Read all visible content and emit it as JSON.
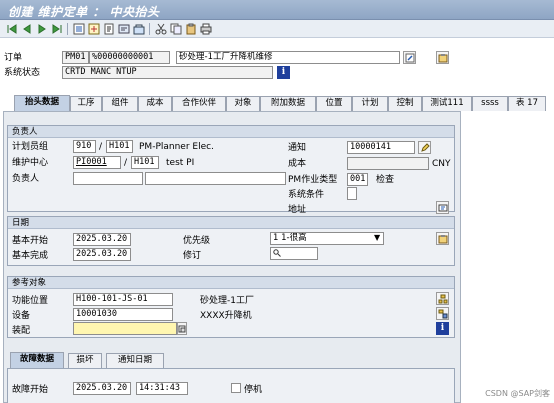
{
  "window": {
    "title": "创建 维护定单 ： 中央抬头"
  },
  "toolbar": {
    "icons": [
      "first-icon",
      "previous-icon",
      "next-icon",
      "last-icon",
      "operation-overview-icon",
      "components-icon",
      "costs-icon",
      "partner-icon",
      "objects-icon"
    ]
  },
  "header": {
    "order_label": "订单",
    "order_type": "PM01",
    "order_number": "%00000000001",
    "order_text": "砂处理-1工厂升降机维修",
    "status_label": "系统状态",
    "status_value": "CRTD MANC NTUP"
  },
  "tabs": [
    {
      "label": "抬头数据",
      "active": true
    },
    {
      "label": "工序",
      "active": false
    },
    {
      "label": "组件",
      "active": false
    },
    {
      "label": "成本",
      "active": false
    },
    {
      "label": "合作伙伴",
      "active": false
    },
    {
      "label": "对象",
      "active": false
    },
    {
      "label": "附加数据",
      "active": false
    },
    {
      "label": "位置",
      "active": false
    },
    {
      "label": "计划",
      "active": false
    },
    {
      "label": "控制",
      "active": false
    },
    {
      "label": "测试111",
      "active": false
    },
    {
      "label": "ssss",
      "active": false
    },
    {
      "label": "表 17",
      "active": false
    }
  ],
  "responsible": {
    "title": "负责人",
    "planner_group_label": "计划员组",
    "planner_group": "910",
    "planner_plant": "H101",
    "planner_group_desc": "PM-Planner Elec.",
    "work_center_label": "维护中心",
    "work_center": "PI0001",
    "work_center_plant": "H101",
    "work_center_desc": "test PI",
    "person_label": "负责人",
    "notification_label": "通知",
    "notification": "10000141",
    "cost_label": "成本",
    "currency": "CNY",
    "pm_activity_label": "PM作业类型",
    "pm_activity": "001",
    "pm_activity_desc": "检查",
    "system_condition_label": "系统条件",
    "address_label": "地址"
  },
  "dates": {
    "title": "日期",
    "basic_start_label": "基本开始",
    "basic_start": "2025.03.20",
    "basic_finish_label": "基本完成",
    "basic_finish": "2025.03.20",
    "priority_label": "优先级",
    "priority": "1 1-很高",
    "revision_label": "修订"
  },
  "reference": {
    "title": "参考对象",
    "func_loc_label": "功能位置",
    "func_loc": "H100-101-JS-01",
    "func_loc_desc": "砂处理-1工厂",
    "equipment_label": "设备",
    "equipment": "10001030",
    "equipment_desc": "XXXX升降机",
    "assembly_label": "装配"
  },
  "subtabs": [
    {
      "label": "故障数据",
      "active": true
    },
    {
      "label": "损坏",
      "active": false
    },
    {
      "label": "通知日期",
      "active": false
    }
  ],
  "malfunction": {
    "start_label": "故障开始",
    "start_date": "2025.03.20",
    "start_time": "14:31:43",
    "breakdown_label": "停机"
  },
  "watermark": "CSDN @SAP剑客",
  "colors": {
    "title_bar": "#8ea5c4",
    "active_tab": "#c3d1e4",
    "highlight_field": "#fff6b0"
  }
}
